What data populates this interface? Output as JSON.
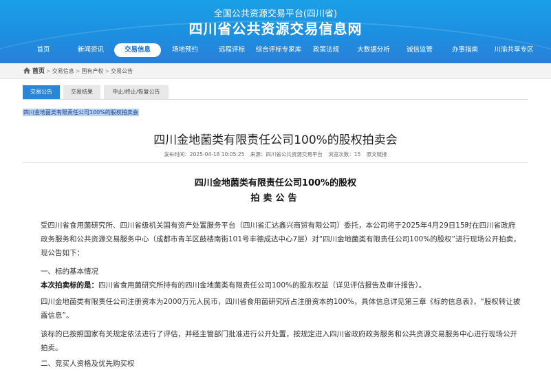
{
  "header": {
    "subtitle": "全国公共资源交易平台(四川省)",
    "title": "四川省公共资源交易信息网"
  },
  "nav": {
    "items": [
      {
        "label": "首页"
      },
      {
        "label": "新闻资讯"
      },
      {
        "label": "交易信息",
        "active": true
      },
      {
        "label": "场地预约"
      },
      {
        "label": "远程评标"
      },
      {
        "label": "综合评标专家库"
      },
      {
        "label": "政策法规"
      },
      {
        "label": "大数据分析"
      },
      {
        "label": "诚信监管"
      },
      {
        "label": "办事指南"
      },
      {
        "label": "川渝共享专区"
      }
    ]
  },
  "breadcrumb": {
    "home": "首页",
    "items": [
      "交易信息",
      "国有产权",
      "交易公告"
    ]
  },
  "tabs": [
    "交易公告",
    "交易结果",
    "中止/终止/恢复公告"
  ],
  "selected_title": "四川金地菌类有限责任公司100%的股权拍卖会",
  "article": {
    "title": "四川金地菌类有限责任公司100%的股权拍卖会",
    "meta": {
      "publish_time": "发布时间：2025-04-18 10:05:25",
      "source": "来源：四川省公共资源交易平台",
      "views": "浏览次数：15",
      "original_link": "原文链接"
    },
    "heading1": "四川金地菌类有限责任公司100%的股权",
    "heading2": "拍卖公告",
    "intro": "受四川省食用菌研究所、四川省级机关国有资产处置服务平台（四川省汇达鑫兴商贸有限公司）委托，本公司将于2025年4月29日15时在四川省政府政务服务和公共资源交易服务中心（成都市青羊区鼓楼南街101号丰德成达中心7层）对“四川金地菌类有限责任公司100%的股权”进行现场公开拍卖，现公告如下：",
    "section1": "一、标的基本情况",
    "subject_label": "本次拍卖标的是：",
    "subject_text": "四川省食用菌研究所持有的四川金地菌类有限责任公司100%的股东权益（详见评估报告及审计报告）。",
    "capital": "四川金地菌类有限责任公司注册资本为2000万元人民币，四川省食用菌研究所占注册资本的100%，具体信息详见第三章《标的信息表》，“股权转让披露信息”。",
    "approval": "该标的已按照国家有关规定依法进行了评估，并经主管部门批准进行公开处置，按规定进入四川省政府政务服务和公共资源交易服务中心进行现场公开拍卖。",
    "section2": "二、竞买人资格及优先购买权"
  }
}
